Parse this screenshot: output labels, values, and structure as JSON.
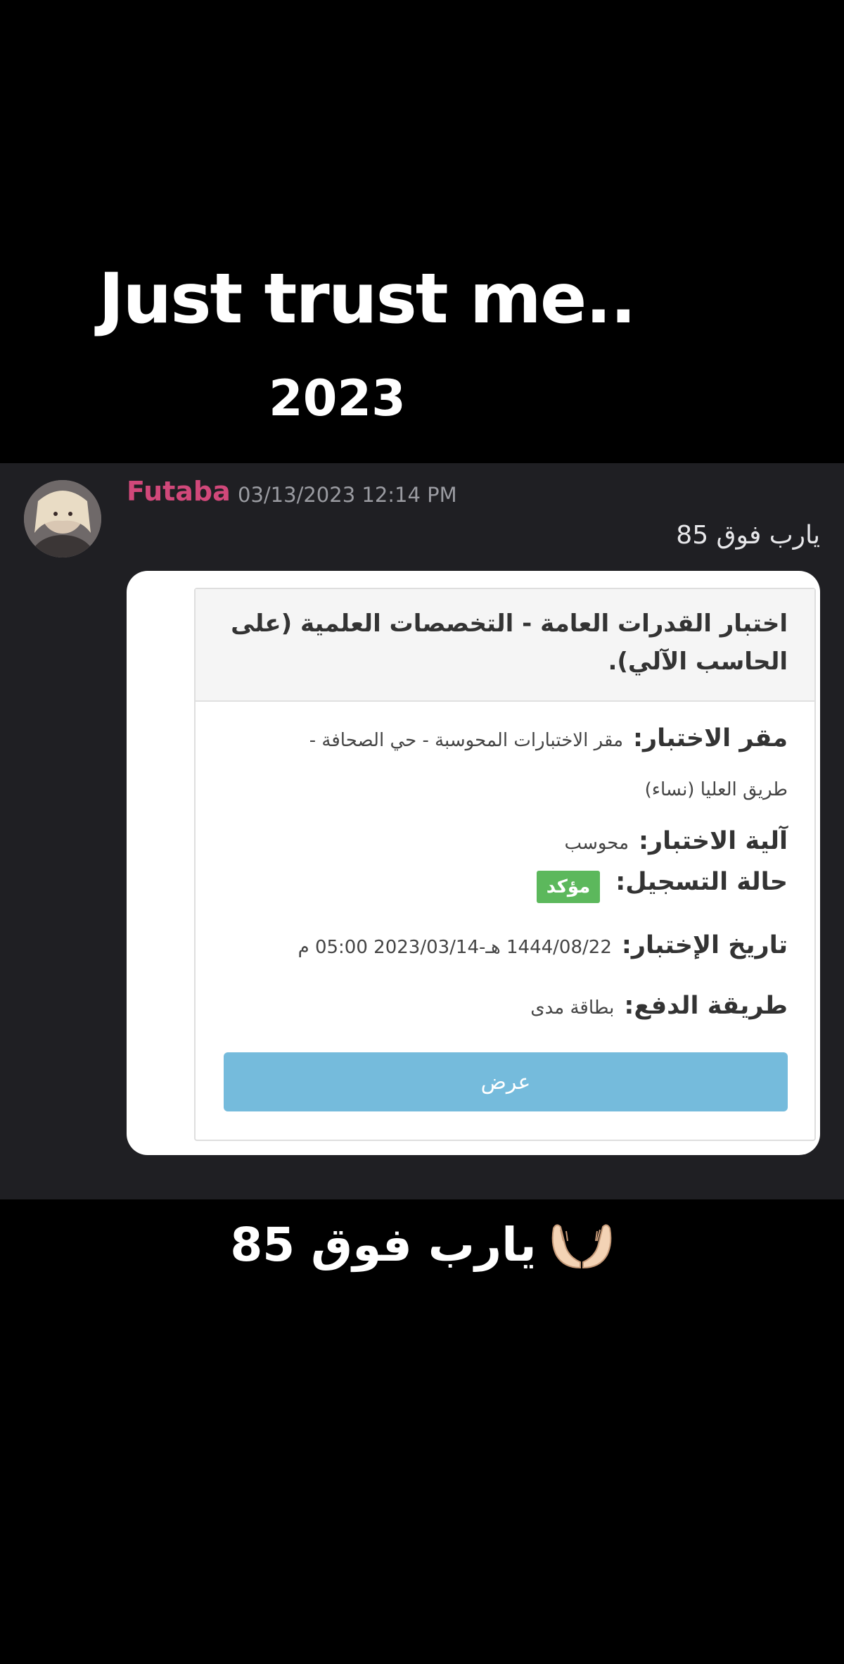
{
  "overlay": {
    "title": "Just trust me..",
    "year": "2023"
  },
  "message": {
    "author": "Futaba",
    "author_color": "#d1487a",
    "timestamp": "03/13/2023 12:14 PM",
    "text": "يارب فوق 85"
  },
  "card": {
    "title": "اختبار القدرات العامة - التخصصات العلمية (على الحاسب الآلي).",
    "location_label": "مقر الاختبار:",
    "location_value": "مقر الاختبارات المحوسبة - حي الصحافة -",
    "location_value_line2": "طريق العليا (نساء)",
    "mechanism_label": "آلية الاختبار:",
    "mechanism_value": "محوسب",
    "status_label": "حالة التسجيل:",
    "status_value": "مؤكد",
    "status_color": "#5cb85c",
    "date_label": "تاريخ الإختبار:",
    "date_value": "1444/08/22 هـ-2023/03/14 05:00 م",
    "payment_label": "طريقة الدفع:",
    "payment_value": "بطاقة مدى",
    "view_button": "عرض",
    "button_color": "#75bbdc"
  },
  "caption": {
    "text": "يارب فوق 85",
    "icon": "praying-hands-icon"
  }
}
